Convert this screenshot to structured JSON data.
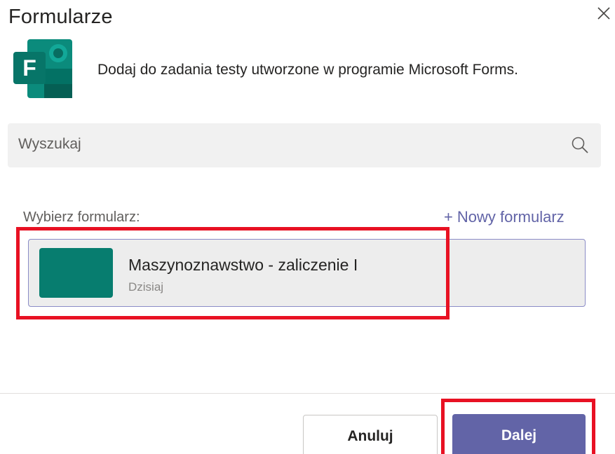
{
  "dialog": {
    "title": "Formularze",
    "close_icon": "close-icon",
    "logo_icon": "microsoft-forms-logo",
    "logo_letter": "F",
    "description": "Dodaj do zadania testy utworzone w programie Microsoft Forms."
  },
  "search": {
    "placeholder": "Wyszukaj",
    "icon": "search-icon"
  },
  "forms_section": {
    "label": "Wybierz formularz:",
    "new_form_plus": "+",
    "new_form_label": "Nowy formularz",
    "items": [
      {
        "name": "Maszynoznawstwo - zaliczenie I",
        "date": "Dzisiaj",
        "thumb_color": "#077d6f"
      }
    ]
  },
  "footer": {
    "cancel_label": "Anuluj",
    "next_label": "Dalej"
  },
  "colors": {
    "accent": "#6264a7",
    "highlight": "#e81123",
    "forms_green": "#077d6f"
  }
}
